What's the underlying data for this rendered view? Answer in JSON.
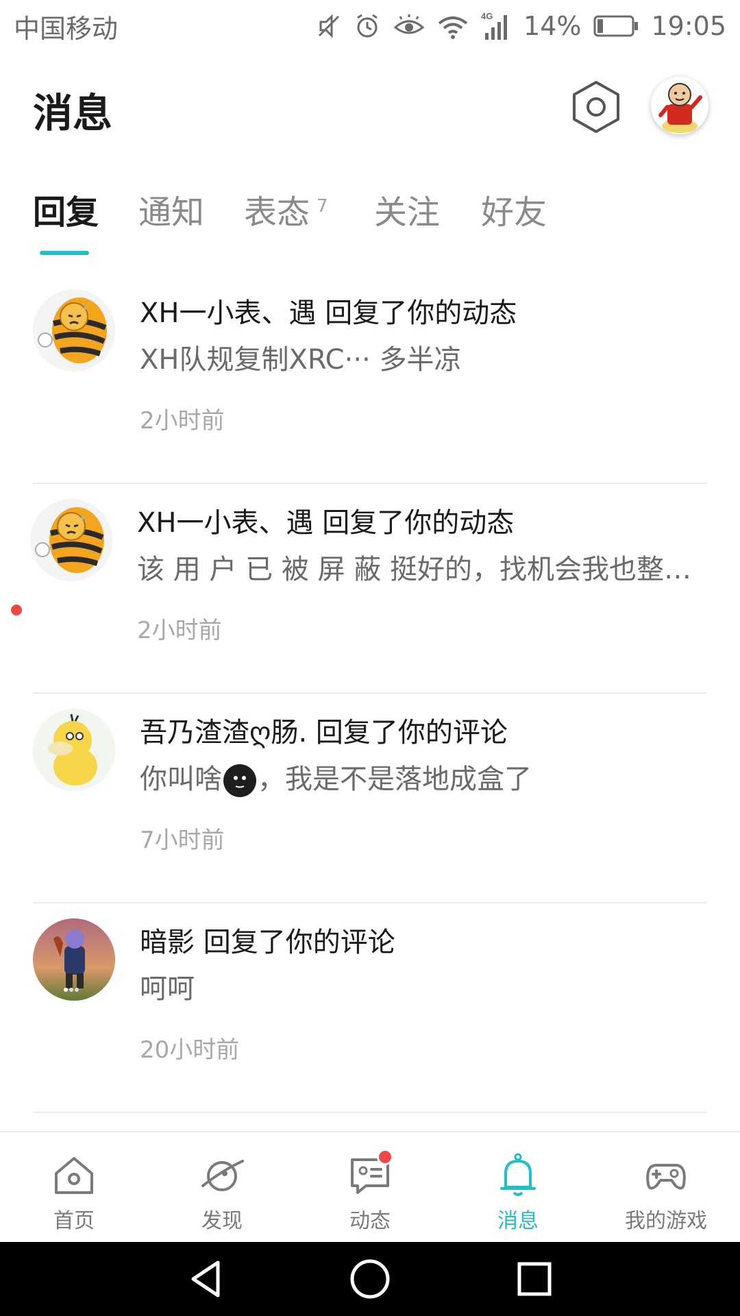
{
  "status_bar": {
    "carrier": "中国移动",
    "network": "4G",
    "battery": "14%",
    "time": "19:05"
  },
  "header": {
    "title": "消息",
    "settings_icon": "hexagon-gear-icon"
  },
  "tabs": [
    {
      "label": "回复",
      "active": true
    },
    {
      "label": "通知"
    },
    {
      "label": "表态",
      "badge": "7"
    },
    {
      "label": "关注"
    },
    {
      "label": "好友"
    }
  ],
  "messages": [
    {
      "title": "XH一小表、遇 回复了你的动态",
      "body": "XH队规复制XRC··· 多半凉",
      "time": "2小时前",
      "unread": false
    },
    {
      "title": "XH一小表、遇 回复了你的动态",
      "body": "该 用 户 已 被 屏 蔽 挺好的，找机会我也整…",
      "time": "2小时前",
      "unread": true
    },
    {
      "title": "吾乃渣渣ღ肠. 回复了你的评论",
      "body_before": "你叫啥",
      "body_after": "，我是不是落地成盒了",
      "time": "7小时前",
      "unread": false
    },
    {
      "title": "暗影 回复了你的评论",
      "body": "呵呵",
      "time": "20小时前",
      "unread": false
    }
  ],
  "bottom_nav": [
    {
      "label": "首页",
      "icon": "home-icon"
    },
    {
      "label": "发现",
      "icon": "planet-icon"
    },
    {
      "label": "动态",
      "icon": "chat-icon",
      "has_dot": true
    },
    {
      "label": "消息",
      "icon": "bell-icon",
      "active": true
    },
    {
      "label": "我的游戏",
      "icon": "gamepad-icon"
    }
  ],
  "colors": {
    "accent": "#1fbfc9",
    "unread": "#f04848"
  }
}
